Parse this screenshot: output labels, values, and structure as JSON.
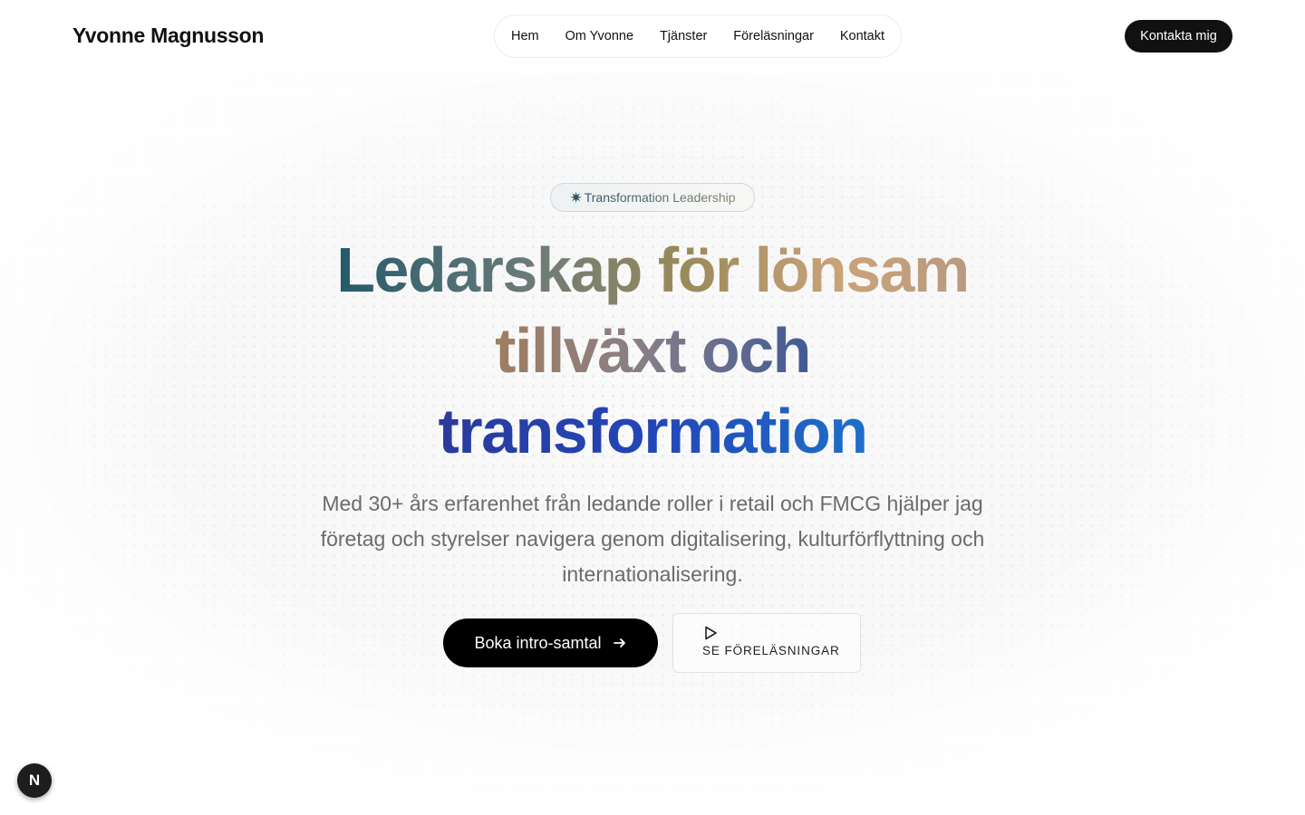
{
  "header": {
    "brand": "Yvonne Magnusson",
    "nav": [
      "Hem",
      "Om Yvonne",
      "Tjänster",
      "Föreläsningar",
      "Kontakt"
    ],
    "cta": "Kontakta mig"
  },
  "hero": {
    "badge": "Transformation Leadership",
    "headline": {
      "line1_a": "Ledarskap",
      "line1_b": "för",
      "line1_c": "lönsam",
      "line2_a": "tillväxt",
      "line2_b": "och",
      "line3": "transformation"
    },
    "lead": "Med 30+ års erfarenhet från ledande roller i retail och FMCG hjälper jag företag och styrelser navigera genom digitalisering, kulturförflyttning och internationalisering.",
    "primary_button": "Boka intro-samtal",
    "secondary_button": "SE FÖRELÄSNINGAR"
  },
  "dev_badge": {
    "letter": "N"
  },
  "icons": {
    "badge": "star-icon",
    "primary_button": "arrow-right-icon",
    "secondary_button": "play-icon"
  }
}
